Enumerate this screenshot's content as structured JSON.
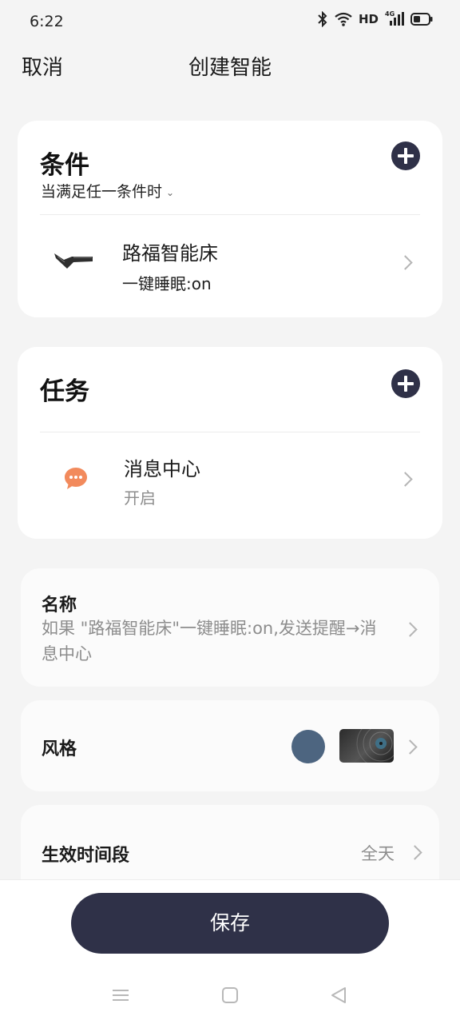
{
  "status_bar": {
    "time": "6:22",
    "network_label": "HD",
    "signal_label": "4G",
    "icons": [
      "bluetooth-icon",
      "wifi-icon",
      "signal-icon",
      "battery-icon"
    ]
  },
  "header": {
    "cancel_label": "取消",
    "title": "创建智能"
  },
  "conditions": {
    "title": "条件",
    "mode_label": "当满足任一条件时",
    "items": [
      {
        "title": "路福智能床",
        "subtitle": "一键睡眠:on",
        "icon": "smart-bed-icon"
      }
    ]
  },
  "tasks": {
    "title": "任务",
    "items": [
      {
        "title": "消息中心",
        "subtitle": "开启",
        "icon": "message-center-icon"
      }
    ]
  },
  "name_field": {
    "label": "名称",
    "value": "如果 \"路福智能床\"一键睡眠:on,发送提醒→消息中心"
  },
  "style_field": {
    "label": "风格",
    "color": "#4d6580"
  },
  "period_field": {
    "label": "生效时间段",
    "value": "全天"
  },
  "save_label": "保存",
  "colors": {
    "accent": "#2f3148",
    "message_icon": "#f28a5c",
    "muted_text": "#8d8d8d"
  }
}
